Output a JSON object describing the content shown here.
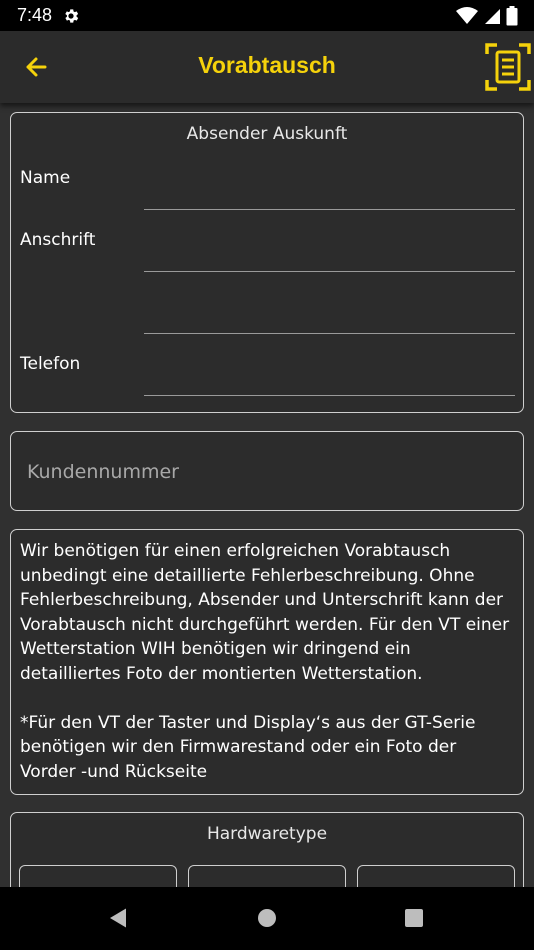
{
  "status_bar": {
    "time": "7:48",
    "icons": [
      "settings-gear-icon",
      "wifi-icon",
      "signal-icon",
      "battery-icon"
    ]
  },
  "app_bar": {
    "title": "Vorabtausch",
    "back_icon": "arrow-left-icon",
    "action_icon": "document-scan-icon",
    "accent_color": "#f5d20b"
  },
  "sender": {
    "title": "Absender Auskunft",
    "fields": [
      {
        "label": "Name",
        "value": ""
      },
      {
        "label": "Anschrift",
        "value": ""
      },
      {
        "label": "",
        "value": ""
      },
      {
        "label": "Telefon",
        "value": ""
      }
    ]
  },
  "customer_number": {
    "placeholder": "Kundennummer",
    "value": ""
  },
  "info": {
    "paragraph1": "Wir benötigen für einen erfolgreichen Vorabtausch\nunbedingt eine detaillierte Fehlerbeschreibung. Ohne\nFehlerbeschreibung, Absender und Unterschrift kann der\nVorabtausch nicht durchgeführt werden. Für den VT einer\nWetterstation WIH benötigen wir dringend ein\ndetailliertes Foto der montierten Wetterstation.",
    "paragraph2": "*Für den VT der Taster und Display‘s aus der GT-Serie\nbenötigen wir den Firmwarestand oder ein Foto der\nVorder -und Rückseite"
  },
  "hardware": {
    "title": "Hardwaretype"
  },
  "nav_bar": {
    "icons": [
      "back-triangle-icon",
      "home-circle-icon",
      "recents-square-icon"
    ]
  },
  "colors": {
    "background": "#303030",
    "card_border": "#cfcfcf",
    "status_bar": "#000000"
  }
}
